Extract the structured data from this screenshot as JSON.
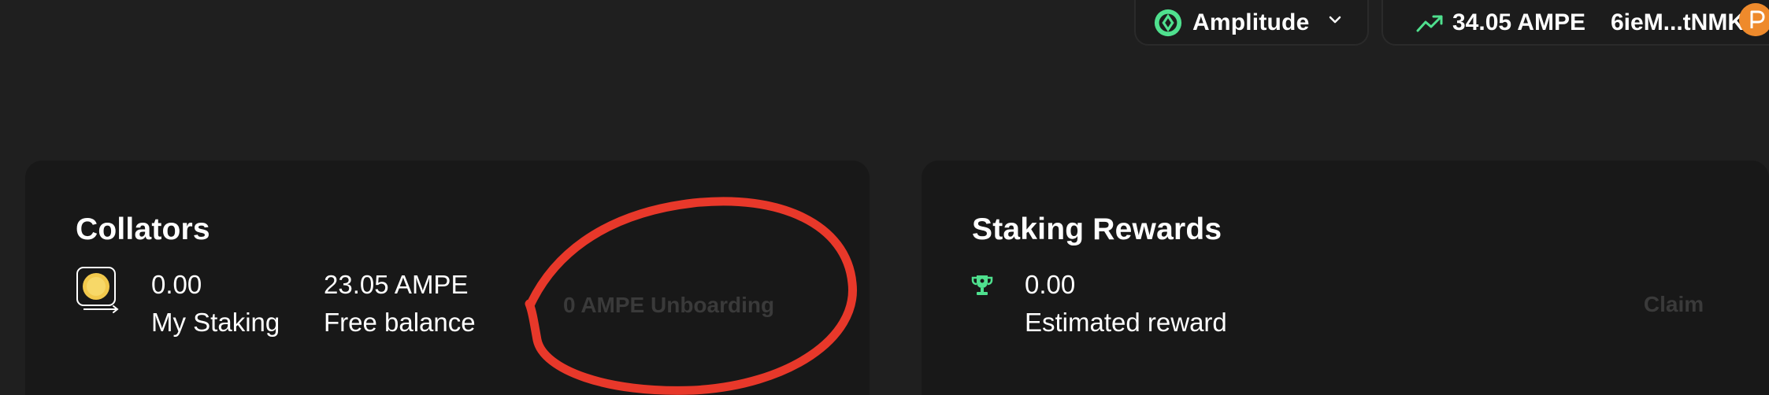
{
  "header": {
    "network": {
      "name": "Amplitude",
      "icon": "amplitude-logo-icon"
    },
    "account": {
      "balance": "34.05 AMPE",
      "address": "6ieM...tNMK",
      "trend_icon": "trending-up-icon",
      "avatar_icon": "polkadot-icon"
    }
  },
  "collators_card": {
    "title": "Collators",
    "my_staking_value": "0.00",
    "my_staking_label": "My Staking",
    "free_balance_value": "23.05 AMPE",
    "free_balance_label": "Free balance",
    "unboarding_text": "0 AMPE Unboarding"
  },
  "rewards_card": {
    "title": "Staking Rewards",
    "estimated_value": "0.00",
    "estimated_label": "Estimated reward",
    "claim_label": "Claim"
  },
  "colors": {
    "background": "#1f1f1f",
    "card": "#181818",
    "accent_green": "#4fe08e",
    "coin_yellow": "#f2c94c",
    "polkadot_orange": "#ee8a2c",
    "annotation_red": "#e8382a",
    "disabled_text": "#3a3a3a"
  }
}
